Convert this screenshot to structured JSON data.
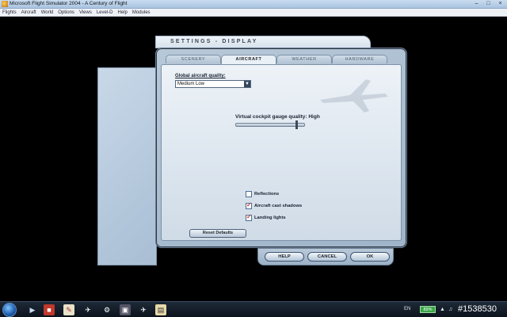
{
  "window": {
    "title": "Microsoft Flight Simulator 2004 - A Century of Flight",
    "controls": {
      "minimize": "–",
      "maximize": "□",
      "close": "×"
    }
  },
  "menubar": {
    "items": [
      "Flights",
      "Aircraft",
      "World",
      "Options",
      "Views",
      "Level-D",
      "Help",
      "Modules"
    ]
  },
  "dialog": {
    "title": "SETTINGS - DISPLAY",
    "tabs": [
      {
        "label": "SCENERY",
        "active": false
      },
      {
        "label": "AIRCRAFT",
        "active": true
      },
      {
        "label": "WEATHER",
        "active": false
      },
      {
        "label": "HARDWARE",
        "active": false
      }
    ],
    "global_quality": {
      "label": "Global aircraft quality:",
      "value": "Medium Low"
    },
    "gauge_quality": {
      "label": "Virtual cockpit gauge quality: High",
      "level": 0.9
    },
    "checkboxes": [
      {
        "label": "Reflections",
        "checked": false
      },
      {
        "label": "Aircraft cast shadows",
        "checked": true
      },
      {
        "label": "Landing lights",
        "checked": true
      }
    ],
    "reset_label": "Reset Defaults",
    "buttons": {
      "help": "HELP",
      "cancel": "CANCEL",
      "ok": "OK"
    }
  },
  "taskbar": {
    "language": "EN",
    "battery": "89%",
    "tray_id": "#1538530"
  },
  "colors": {
    "accent": "#33475f",
    "check_mark": "#c0392b",
    "battery": "#3aa548"
  }
}
